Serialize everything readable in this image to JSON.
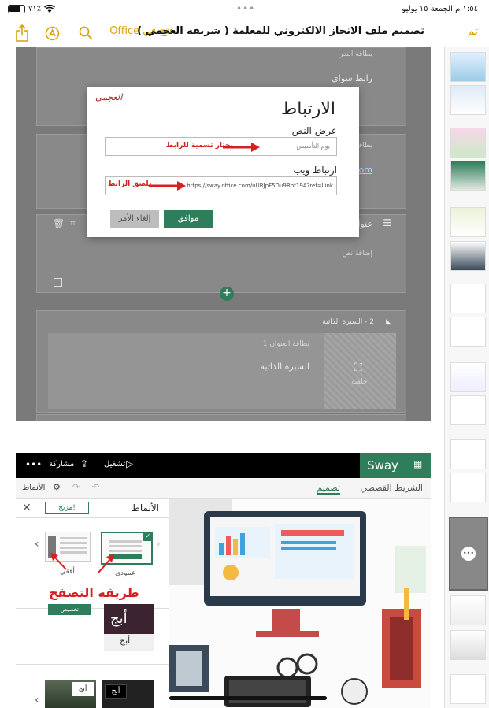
{
  "status_bar": {
    "time": "١:٥٤ م  الجمعة ١٥ يوليو",
    "battery": "٧١٪",
    "wifi_icon": "wifi-icon",
    "more_dots": "•••"
  },
  "toolbar": {
    "done": "تم",
    "title": "تصميم ملف الانجاز الالكتروني للمعلمة ( شريفه العجمي )",
    "open_in_office": "فتح في Office",
    "share_icon": "share-icon",
    "markup_icon": "markup-icon",
    "search_icon": "search-icon",
    "accent_color": "#d9a100"
  },
  "doc": {
    "text_card": "بطاقة النص",
    "link_label": "رابط سواي",
    "text_card_2": "بطاقة النص",
    "link_url_partial": "ffice.com",
    "heading_label": "عنوان",
    "add_text": "إضافة نص",
    "section_title": "2 - السيرة الذاتية",
    "heading_card": "بطاقة العنوان 1",
    "cv_text": "السيرة الذاتية",
    "background_label": "خلفية"
  },
  "dialog": {
    "title": "الارتباط",
    "display_text_label": "عرض النص",
    "display_text_value": "يوم التأسيس",
    "web_link_label": "ارتباط ويب",
    "web_link_value": "https://sway.office.com/uURJpF5Du9Rht19A?ref=Link",
    "note_name_link": "نختار تسمية للرابط",
    "note_paste_link": "نلصق الرابط",
    "ok": "موافق",
    "cancel": "إلغاء الأمر",
    "signature": "العجمي"
  },
  "sway": {
    "brand": "Sway",
    "play": "تشغيل",
    "share": "مشاركة",
    "more": "•••",
    "tab_storyline": "الشريط القصصي",
    "tab_design": "تصميم",
    "styles_button": "الأنماط",
    "panel_title": "الأنماط",
    "remix": "مزيج!",
    "vertical": "عمودي",
    "horizontal": "أفقي",
    "nav_method": "طريقة التصفح",
    "customize": "تخصيص",
    "sample_text": "أبج",
    "accent_color": "#2e7d5b"
  }
}
